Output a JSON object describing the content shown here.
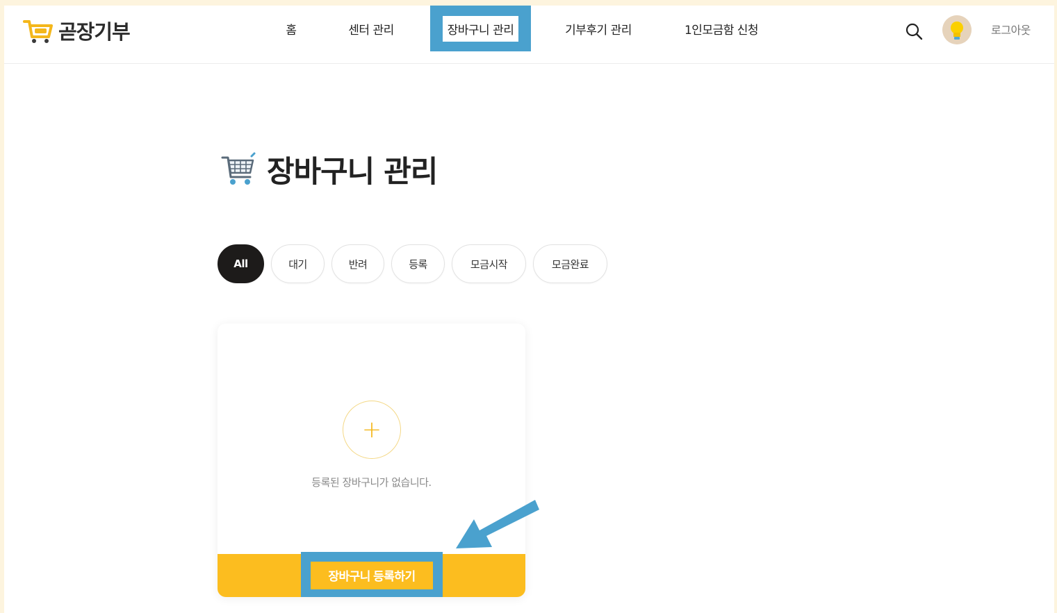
{
  "brand": {
    "name": "곧장기부"
  },
  "nav": {
    "items": [
      {
        "label": "홈",
        "active": false
      },
      {
        "label": "센터 관리",
        "active": false
      },
      {
        "label": "장바구니 관리",
        "active": true
      },
      {
        "label": "기부후기 관리",
        "active": false
      },
      {
        "label": "1인모금함 신청",
        "active": false
      }
    ]
  },
  "header": {
    "logout_label": "로그아웃"
  },
  "page": {
    "title": "장바구니 관리"
  },
  "filters": {
    "chips": [
      {
        "label": "All",
        "active": true
      },
      {
        "label": "대기",
        "active": false
      },
      {
        "label": "반려",
        "active": false
      },
      {
        "label": "등록",
        "active": false
      },
      {
        "label": "모금시작",
        "active": false
      },
      {
        "label": "모금완료",
        "active": false
      }
    ]
  },
  "card": {
    "add_symbol": "+",
    "empty_message": "등록된 장바구니가 없습니다.",
    "register_label": "장바구니 등록하기"
  },
  "colors": {
    "accent_yellow": "#fcbd1f",
    "highlight_blue": "#4aa1ce",
    "chip_active": "#1d1b1a"
  },
  "icons": {
    "logo": "cart-logo-icon",
    "search": "search-icon",
    "avatar": "lightbulb-avatar-icon",
    "title": "shopping-cart-icon",
    "arrow": "pointer-arrow-icon"
  }
}
